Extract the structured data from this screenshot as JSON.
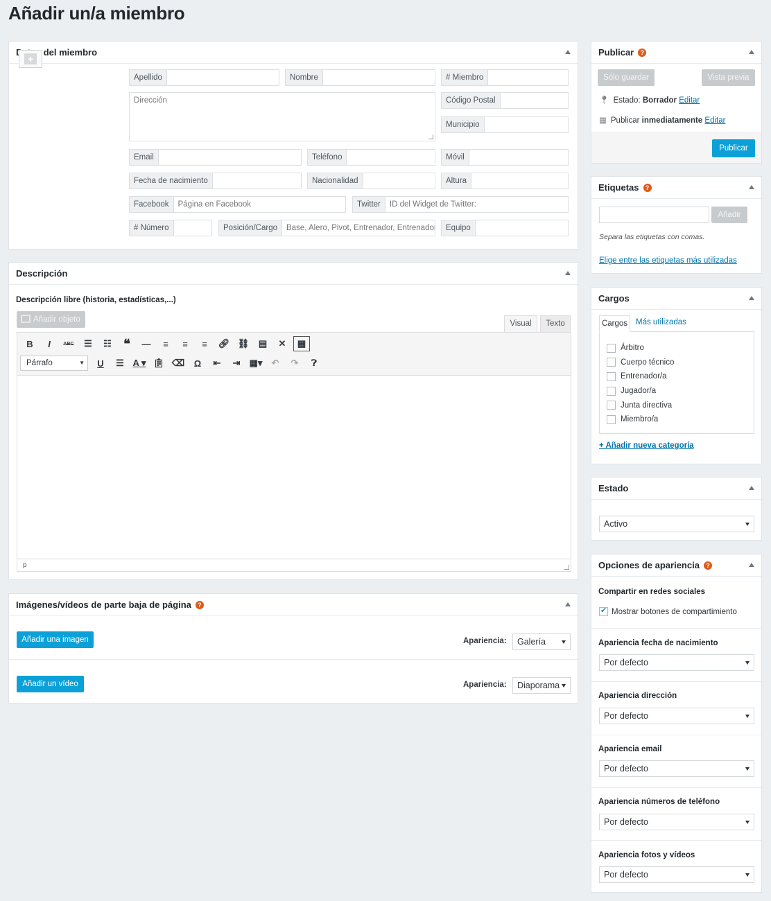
{
  "page": {
    "title": "Añadir un/a miembro"
  },
  "member": {
    "title": "Datos del miembro",
    "apellido": "Apellido",
    "nombre": "Nombre",
    "miembro_num": "# Miembro",
    "direccion": "Dirección",
    "codigo_postal": "Código Postal",
    "municipio": "Municipio",
    "email": "Email",
    "telefono": "Teléfono",
    "movil": "Móvil",
    "fecha_nacimiento": "Fecha de nacimiento",
    "nacionalidad": "Nacionalidad",
    "altura": "Altura",
    "facebook": "Facebook",
    "facebook_placeholder": "Página en Facebook",
    "twitter": "Twitter",
    "twitter_placeholder": "ID del Widget de Twitter:",
    "numero": "# Número",
    "posicion": "Posición/Cargo",
    "posicion_placeholder": "Base, Alero, Pivot, Entrenador, Entrenador",
    "equipo": "Equipo"
  },
  "description": {
    "title": "Descripción",
    "label": "Descripción libre (historia, estadísticas,...)",
    "add_media": "Añadir objeto",
    "tab_visual": "Visual",
    "tab_text": "Texto",
    "format_select": "Párrafo",
    "status_path": "p"
  },
  "media": {
    "title": "Imágenes/vídeos de parte baja de página",
    "add_image": "Añadir una imagen",
    "add_video": "Añadir un vídeo",
    "appearance_label": "Apariencia:",
    "image_appearance": "Galería",
    "video_appearance": "Diaporama"
  },
  "publish": {
    "title": "Publicar",
    "save_draft": "Sólo guardar",
    "preview": "Vista previa",
    "status_label": "Estado:",
    "status_value": "Borrador",
    "edit": "Editar",
    "publish_label": "Publicar",
    "publish_value": "inmediatamente",
    "publish_button": "Publicar"
  },
  "tags": {
    "title": "Etiquetas",
    "add_button": "Añadir",
    "hint": "Separa las etiquetas con comas.",
    "popular_link": "Elige entre las etiquetas más utilizadas"
  },
  "cargos": {
    "title": "Cargos",
    "tab_all": "Cargos",
    "tab_popular": "Más utilizadas",
    "items": [
      "Árbitro",
      "Cuerpo técnico",
      "Entrenador/a",
      "Jugador/a",
      "Junta directiva",
      "Miembro/a"
    ],
    "add_new": "+ Añadir nueva categoría"
  },
  "estado": {
    "title": "Estado",
    "value": "Activo"
  },
  "appearance": {
    "title": "Opciones de apariencia",
    "share_label": "Compartir en redes sociales",
    "share_checkbox": "Mostrar botones de compartimiento",
    "birthdate_label": "Apariencia fecha de nacimiento",
    "address_label": "Apariencia dirección",
    "email_label": "Apariencia email",
    "phone_label": "Apariencia números de teléfono",
    "photos_label": "Apariencia fotos y vídeos",
    "default_value": "Por defecto"
  }
}
